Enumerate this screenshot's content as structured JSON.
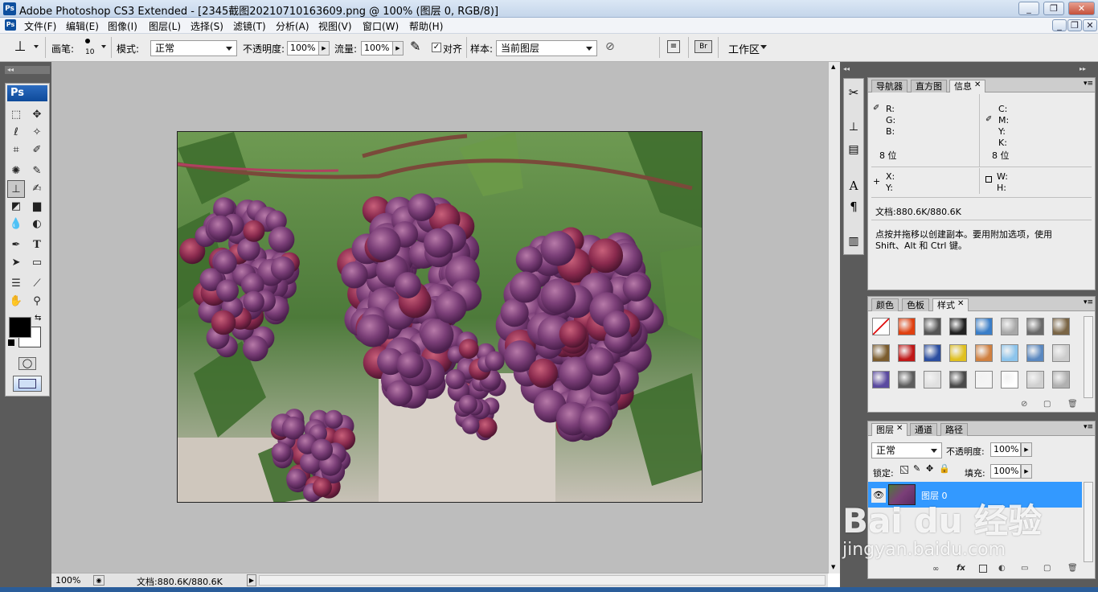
{
  "app": {
    "logo": "Ps",
    "title": "Adobe Photoshop CS3 Extended - [2345截图20210710163609.png @ 100% (图层 0, RGB/8)]"
  },
  "window_controls": [
    "_",
    "❐",
    "✕"
  ],
  "doc_controls": [
    "_",
    "❐",
    "✕"
  ],
  "menu": [
    "文件(F)",
    "编辑(E)",
    "图像(I)",
    "图层(L)",
    "选择(S)",
    "滤镜(T)",
    "分析(A)",
    "视图(V)",
    "窗口(W)",
    "帮助(H)"
  ],
  "options": {
    "brush_label": "画笔:",
    "brush_size": "10",
    "mode_label": "模式:",
    "mode_value": "正常",
    "opacity_label": "不透明度:",
    "opacity_value": "100%",
    "flow_label": "流量:",
    "flow_value": "100%",
    "aligned_label": "对齐",
    "aligned_checked": true,
    "sample_label": "样本:",
    "sample_value": "当前图层",
    "workspace_label": "工作区"
  },
  "tools": {
    "ps_badge": "Ps",
    "foreground_color": "#000000",
    "background_color": "#ffffff"
  },
  "status": {
    "zoom": "100%",
    "doc_size": "文档:880.6K/880.6K"
  },
  "info_panel": {
    "tabs": [
      "导航器",
      "直方图",
      "信息"
    ],
    "active_tab": "信息",
    "rgb_labels": [
      "R:",
      "G:",
      "B:"
    ],
    "cmyk_labels": [
      "C:",
      "M:",
      "Y:",
      "K:"
    ],
    "bits_left": "8 位",
    "bits_right": "8 位",
    "xy_labels": [
      "X:",
      "Y:"
    ],
    "wh_labels": [
      "W:",
      "H:"
    ],
    "doc_size": "文档:880.6K/880.6K",
    "hint_line1": "点按并拖移以创建副本。要用附加选项，使用",
    "hint_line2": "Shift、Alt 和 Ctrl 键。"
  },
  "swatches_panel": {
    "tabs": [
      "颜色",
      "色板",
      "样式"
    ],
    "active_tab": "样式",
    "styles": [
      {
        "name": "none-style",
        "color": "#ffffff"
      },
      {
        "name": "fire-style",
        "color": "#e04010"
      },
      {
        "name": "gray-style",
        "color": "#555555"
      },
      {
        "name": "chrome-style",
        "color": "#222222"
      },
      {
        "name": "blue-glass-style",
        "color": "#3a7ec8"
      },
      {
        "name": "silver-style",
        "color": "#a8a8a8"
      },
      {
        "name": "metal-style",
        "color": "#6a6a6a"
      },
      {
        "name": "bronze-style",
        "color": "#7a6545"
      },
      {
        "name": "wood-style",
        "color": "#7b5c2d"
      },
      {
        "name": "red-style",
        "color": "#c01818"
      },
      {
        "name": "rainbow-style",
        "color": "#2b4ea0"
      },
      {
        "name": "gold-style",
        "color": "#e0c020"
      },
      {
        "name": "sunset-style",
        "color": "#d08040"
      },
      {
        "name": "sky-style",
        "color": "#8cc4ec"
      },
      {
        "name": "landscape-style",
        "color": "#5a88c0"
      },
      {
        "name": "crystal-style",
        "color": "#cccccc"
      },
      {
        "name": "purple-style",
        "color": "#5a4aa0"
      },
      {
        "name": "dark-gray-style",
        "color": "#5e5e5e"
      },
      {
        "name": "light-style",
        "color": "#e0e0e0"
      },
      {
        "name": "charcoal-style",
        "color": "#4a4a4a"
      },
      {
        "name": "outline-style",
        "color": "#f4f4f4"
      },
      {
        "name": "white-style",
        "color": "#ffffff"
      },
      {
        "name": "bevel-style",
        "color": "#d0d0d0"
      },
      {
        "name": "steel-style",
        "color": "#b0b0b0"
      }
    ]
  },
  "layers_panel": {
    "tabs": [
      "图层",
      "通道",
      "路径"
    ],
    "active_tab": "图层",
    "blend_mode": "正常",
    "opacity_label": "不透明度:",
    "opacity_value": "100%",
    "lock_label": "锁定:",
    "fill_label": "填充:",
    "fill_value": "100%",
    "layer_name": "图层 0",
    "selection_color": "#3399ff"
  },
  "watermark": {
    "line1": "Bai du 经验",
    "line2": "jingyan.baidu.com"
  }
}
